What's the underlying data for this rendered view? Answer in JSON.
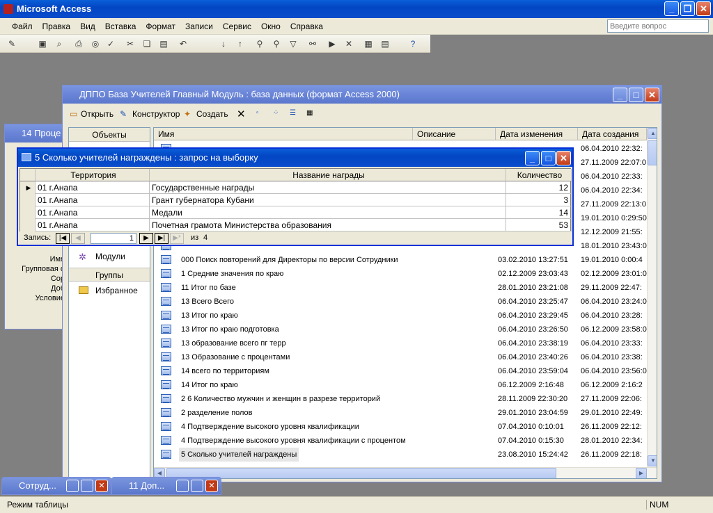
{
  "app": {
    "title": "Microsoft Access"
  },
  "menu": [
    "Файл",
    "Правка",
    "Вид",
    "Вставка",
    "Формат",
    "Записи",
    "Сервис",
    "Окно",
    "Справка"
  ],
  "help_box": {
    "placeholder": "Введите вопрос"
  },
  "behind_window": {
    "title": "14 Проце",
    "labels": [
      "Имя",
      "Групповая о",
      "Сор",
      "Доб",
      "Условие"
    ]
  },
  "db_window": {
    "title": "ДППО База Учителей Главный Модуль  : база данных (формат Access 2000)",
    "toolbar": {
      "open": "Открыть",
      "design": "Конструктор",
      "create": "Создать"
    },
    "objects_header": "Объекты",
    "groups_header": "Группы",
    "nav_modules": "Модули",
    "nav_favorites": "Избранное",
    "columns": {
      "name": "Имя",
      "description": "Описание",
      "modified": "Дата изменения",
      "created": "Дата создания"
    },
    "top_rows": [
      {
        "created": "06.04.2010 22:32:"
      },
      {
        "created": "27.11.2009 22:07:0"
      },
      {
        "created": "06.04.2010 22:33:"
      },
      {
        "created": "06.04.2010 22:34:"
      },
      {
        "created": "27.11.2009 22:13:0"
      },
      {
        "created": "19.01.2010 0:29:50"
      },
      {
        "created": "12.12.2009 21:55:"
      },
      {
        "created": "18.01.2010 23:43:0"
      }
    ],
    "items": [
      {
        "name": "000 Поиск повторений для Директоры по версии Сотрудники",
        "modified": "03.02.2010 13:27:51",
        "created": "19.01.2010 0:00:4"
      },
      {
        "name": "1 Средние значения по краю",
        "modified": "02.12.2009 23:03:43",
        "created": "02.12.2009 23:01:0"
      },
      {
        "name": "11 Итог по базе",
        "modified": "28.01.2010 23:21:08",
        "created": "29.11.2009 22:47:"
      },
      {
        "name": "13 Всего Всего",
        "modified": "06.04.2010 23:25:47",
        "created": "06.04.2010 23:24:0"
      },
      {
        "name": "13 Итог по краю",
        "modified": "06.04.2010 23:29:45",
        "created": "06.04.2010 23:28:"
      },
      {
        "name": "13 Итог по краю подготовка",
        "modified": "06.04.2010 23:26:50",
        "created": "06.12.2009 23:58:0"
      },
      {
        "name": "13 образование всего пг терр",
        "modified": "06.04.2010 23:38:19",
        "created": "06.04.2010 23:33:"
      },
      {
        "name": "13 Образование с процентами",
        "modified": "06.04.2010 23:40:26",
        "created": "06.04.2010 23:38:"
      },
      {
        "name": "14 всего по  территориям",
        "modified": "06.04.2010 23:59:04",
        "created": "06.04.2010 23:56:0"
      },
      {
        "name": "14 Итог по краю",
        "modified": "06.12.2009 2:16:48",
        "created": "06.12.2009 2:16:2"
      },
      {
        "name": "2 6 Количество мужчин и женщин в разрезе территорий",
        "modified": "28.11.2009 22:30:20",
        "created": "27.11.2009 22:06:"
      },
      {
        "name": "2 разделение полов",
        "modified": "29.01.2010 23:04:59",
        "created": "29.01.2010 22:49:"
      },
      {
        "name": "4 Подтверждение высокого уровня квалификации",
        "modified": "07.04.2010 0:10:01",
        "created": "26.11.2009 22:12:"
      },
      {
        "name": "4 Подтверждение высокого уровня квалификации с процентом",
        "modified": "07.04.2010 0:15:30",
        "created": "28.01.2010 22:34:"
      },
      {
        "name": "5 Сколько учителей награждены",
        "modified": "23.08.2010 15:24:42",
        "created": "26.11.2009 22:18:"
      }
    ]
  },
  "query_window": {
    "title": "5 Сколько учителей награждены : запрос на выборку",
    "columns": [
      "Территория",
      "Название награды",
      "Количество"
    ],
    "rows": [
      {
        "territory": "01 г.Анапа",
        "award": "Государственные награды",
        "count": "12"
      },
      {
        "territory": "01 г.Анапа",
        "award": "Грант губернатора Кубани",
        "count": "3"
      },
      {
        "territory": "01 г.Анапа",
        "award": "Медали",
        "count": "14"
      },
      {
        "territory": "01 г.Анапа",
        "award": "Почетная грамота Министерства образования",
        "count": "53"
      }
    ],
    "nav": {
      "label": "Запись:",
      "current": "1",
      "of_label": "из",
      "total": "4"
    }
  },
  "taskbar_windows": [
    {
      "title": "Сотруд..."
    },
    {
      "title": "11 Доп..."
    }
  ],
  "status": {
    "mode": "Режим таблицы",
    "num": "NUM"
  }
}
